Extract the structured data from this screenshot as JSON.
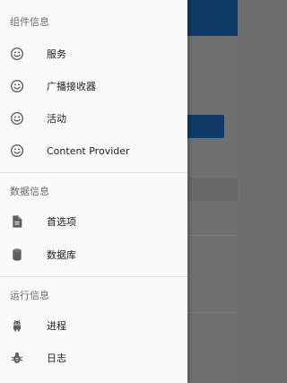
{
  "drawer": {
    "sections": [
      {
        "header": "组件信息",
        "items": [
          {
            "label": "服务",
            "icon": "smiley-icon"
          },
          {
            "label": "广播接收器",
            "icon": "smiley-icon"
          },
          {
            "label": "活动",
            "icon": "smiley-icon"
          },
          {
            "label": "Content Provider",
            "icon": "smiley-icon"
          }
        ]
      },
      {
        "header": "数据信息",
        "items": [
          {
            "label": "首选项",
            "icon": "document-icon"
          },
          {
            "label": "数据库",
            "icon": "database-icon"
          }
        ]
      },
      {
        "header": "运行信息",
        "items": [
          {
            "label": "进程",
            "icon": "android-icon"
          },
          {
            "label": "日志",
            "icon": "bug-icon"
          }
        ]
      }
    ]
  },
  "colors": {
    "drawer_bg": "#fafafa",
    "toolbar": "#0d3a66",
    "icon": "#5f5f5f",
    "scrim": "#6e6e6e"
  }
}
